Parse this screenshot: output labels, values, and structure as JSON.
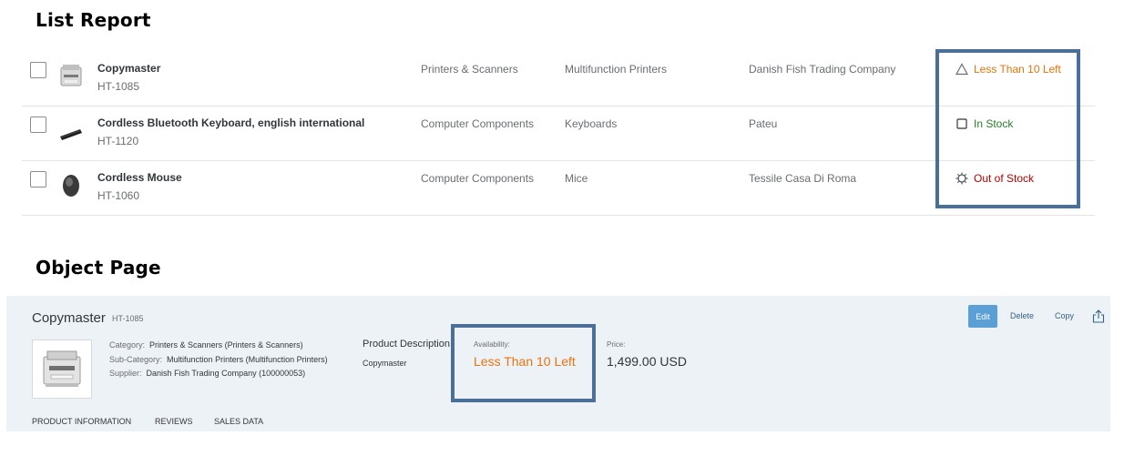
{
  "list_report": {
    "heading": "List Report",
    "rows": [
      {
        "name": "Copymaster",
        "id": "HT-1085",
        "category": "Printers & Scanners",
        "sub_category": "Multifunction Printers",
        "supplier": "Danish Fish Trading Company",
        "status": "Less Than 10 Left",
        "status_icon": "warning-triangle-icon",
        "status_color": "#e9730c",
        "thumbnail": "printer"
      },
      {
        "name": "Cordless Bluetooth Keyboard, english international",
        "id": "HT-1120",
        "category": "Computer Components",
        "sub_category": "Keyboards",
        "supplier": "Pateu",
        "status": "In Stock",
        "status_icon": "square-check-icon",
        "status_color": "#2b7d2b",
        "thumbnail": "keyboard"
      },
      {
        "name": "Cordless Mouse",
        "id": "HT-1060",
        "category": "Computer Components",
        "sub_category": "Mice",
        "supplier": "Tessile Casa Di Roma",
        "status": "Out of Stock",
        "status_icon": "out-of-stock-icon",
        "status_color": "#bb0000",
        "thumbnail": "mouse"
      }
    ]
  },
  "object_page": {
    "heading": "Object Page",
    "title": "Copymaster",
    "title_id": "HT-1085",
    "category_label": "Category:",
    "category_value": "Printers & Scanners (Printers & Scanners)",
    "sub_category_label": "Sub-Category:",
    "sub_category_value": "Multifunction Printers (Multifunction Printers)",
    "supplier_label": "Supplier:",
    "supplier_value": "Danish Fish Trading Company (100000053)",
    "description_label": "Product Description",
    "description_value": "Copymaster",
    "availability_label": "Availability:",
    "availability_value": "Less Than 10 Left",
    "price_label": "Price:",
    "price_value": "1,499.00  USD",
    "actions": {
      "edit": "Edit",
      "delete": "Delete",
      "copy": "Copy"
    },
    "tabs": [
      "PRODUCT INFORMATION",
      "REVIEWS",
      "SALES DATA"
    ]
  },
  "colors": {
    "highlight_border": "#4a6f98",
    "edit_button": "#5b9fd7",
    "warning": "#e9730c",
    "success": "#2b7d2b",
    "error": "#bb0000"
  }
}
